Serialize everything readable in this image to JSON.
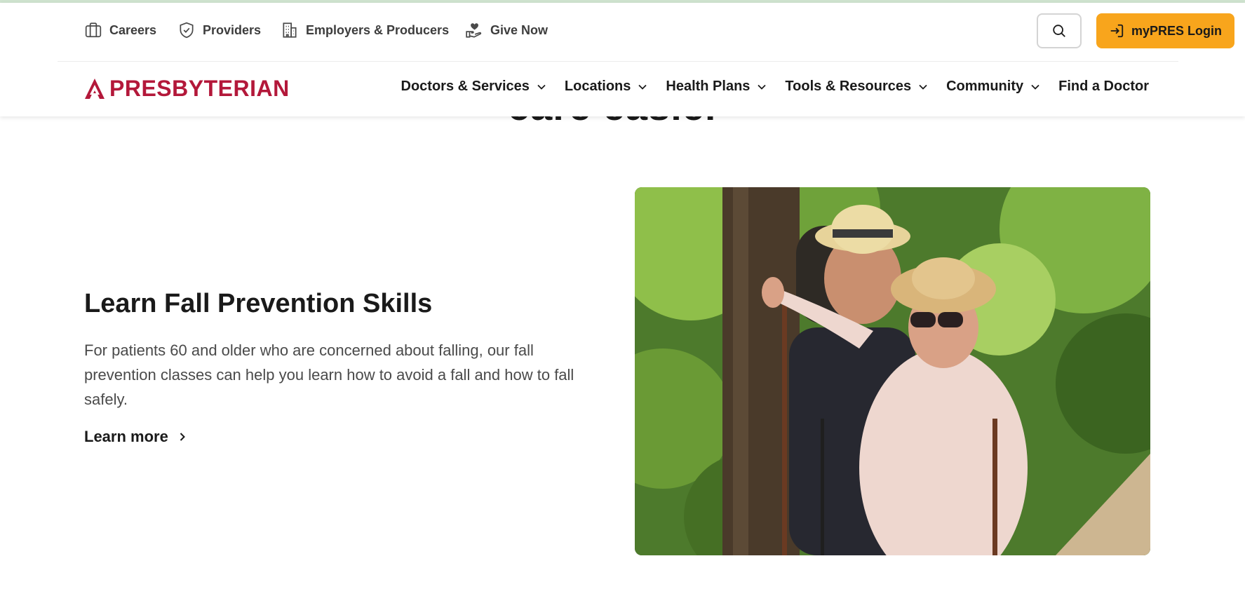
{
  "utility_nav": {
    "careers": "Careers",
    "providers": "Providers",
    "employers": "Employers & Producers",
    "give_now": "Give Now"
  },
  "login": {
    "label": "myPRES Login"
  },
  "brand": {
    "name": "PRESBYTERIAN",
    "color": "#b3183a"
  },
  "main_nav": {
    "doctors": "Doctors & Services",
    "locations": "Locations",
    "health_plans": "Health Plans",
    "tools": "Tools & Resources",
    "community": "Community",
    "find_doctor": "Find a Doctor"
  },
  "section_partial_title": "care easier",
  "feature": {
    "title": "Learn Fall Prevention Skills",
    "description": "For patients 60 and older who are concerned about falling, our fall prevention classes can help you learn how to avoid a fall and how to fall safely.",
    "cta": "Learn more"
  },
  "colors": {
    "accent": "#f8a51c",
    "brand": "#b3183a",
    "top_bar": "#cfe3cf"
  },
  "icons": [
    "briefcase-icon",
    "shield-check-icon",
    "building-icon",
    "heart-hand-icon",
    "search-icon",
    "login-arrow-icon",
    "chevron-down-icon",
    "chevron-right-icon"
  ]
}
